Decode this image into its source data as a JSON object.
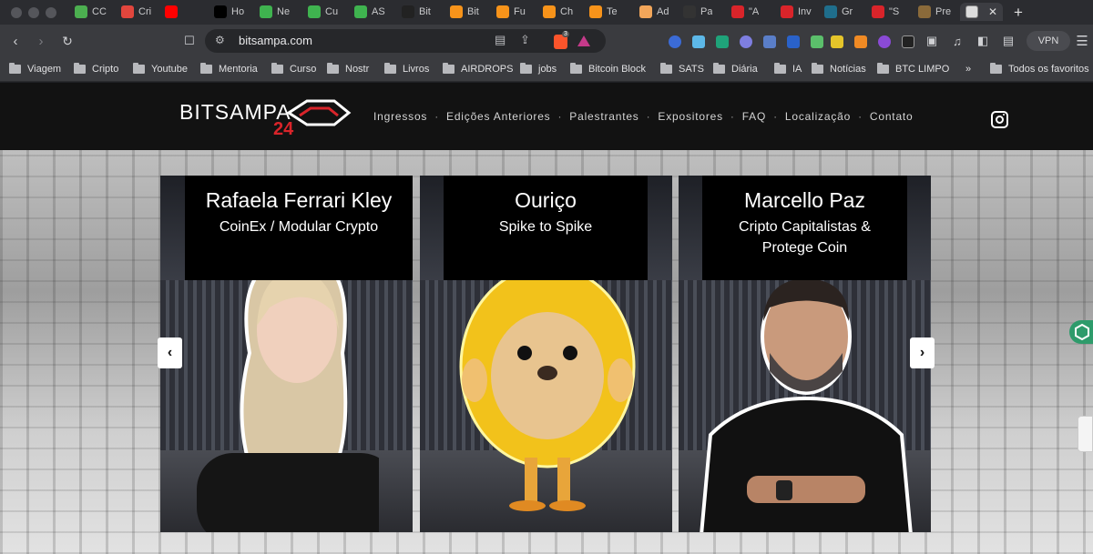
{
  "browser": {
    "tabs": [
      {
        "label": "CC",
        "color": "#4caf50"
      },
      {
        "label": "Cri",
        "color": "#e2463d"
      },
      {
        "label": "",
        "color": "#ff0000"
      },
      {
        "label": "Ho",
        "color": "#000000"
      },
      {
        "label": "Ne",
        "color": "#3fb34f"
      },
      {
        "label": "Cu",
        "color": "#3fb34f"
      },
      {
        "label": "AS",
        "color": "#3fb34f"
      },
      {
        "label": "Bit",
        "color": "#222222"
      },
      {
        "label": "Bit",
        "color": "#f7931a"
      },
      {
        "label": "Fu",
        "color": "#f7931a"
      },
      {
        "label": "Ch",
        "color": "#f7931a"
      },
      {
        "label": "Te",
        "color": "#f7931a"
      },
      {
        "label": "Ad",
        "color": "#f2a65a"
      },
      {
        "label": "Pa",
        "color": "#333333"
      },
      {
        "label": "\"A",
        "color": "#d9242a"
      },
      {
        "label": "Inv",
        "color": "#d9242a"
      },
      {
        "label": "Gr",
        "color": "#1f6e8c"
      },
      {
        "label": "\"S",
        "color": "#d9242a"
      },
      {
        "label": "Pre",
        "color": "#8a6a3a"
      }
    ],
    "url": "bitsampa.com",
    "vpn_label": "VPN",
    "brave_badge": "3",
    "bookmarks": [
      "Viagem",
      "Cripto",
      "Youtube",
      "Mentoria",
      "Curso",
      "Nostr",
      "Livros",
      "AIRDROPS",
      "jobs",
      "Bitcoin Block",
      "SATS",
      "Diária",
      "IA",
      "Notícias",
      "BTC LIMPO"
    ],
    "bookmarks_more": "»",
    "all_bookmarks": "Todos os favoritos"
  },
  "site": {
    "logo_text": "BITSAMPA",
    "logo_year": "24",
    "nav": [
      "Ingressos",
      "Edições Anteriores",
      "Palestrantes",
      "Expositores",
      "FAQ",
      "Localização",
      "Contato"
    ],
    "nav_separator": "·",
    "speakers": [
      {
        "name": "Rafaela Ferrari Kley",
        "company": "CoinEx / Modular Crypto"
      },
      {
        "name": "Ouriço",
        "company": "Spike to Spike"
      },
      {
        "name": "Marcello Paz",
        "company": "Cripto Capitalistas & Protege Coin"
      }
    ],
    "prev_arrow": "‹",
    "next_arrow": "›"
  },
  "colors": {
    "brand_red": "#d9242a",
    "header_bg": "#121212",
    "accent_green": "#2e9b6b"
  }
}
